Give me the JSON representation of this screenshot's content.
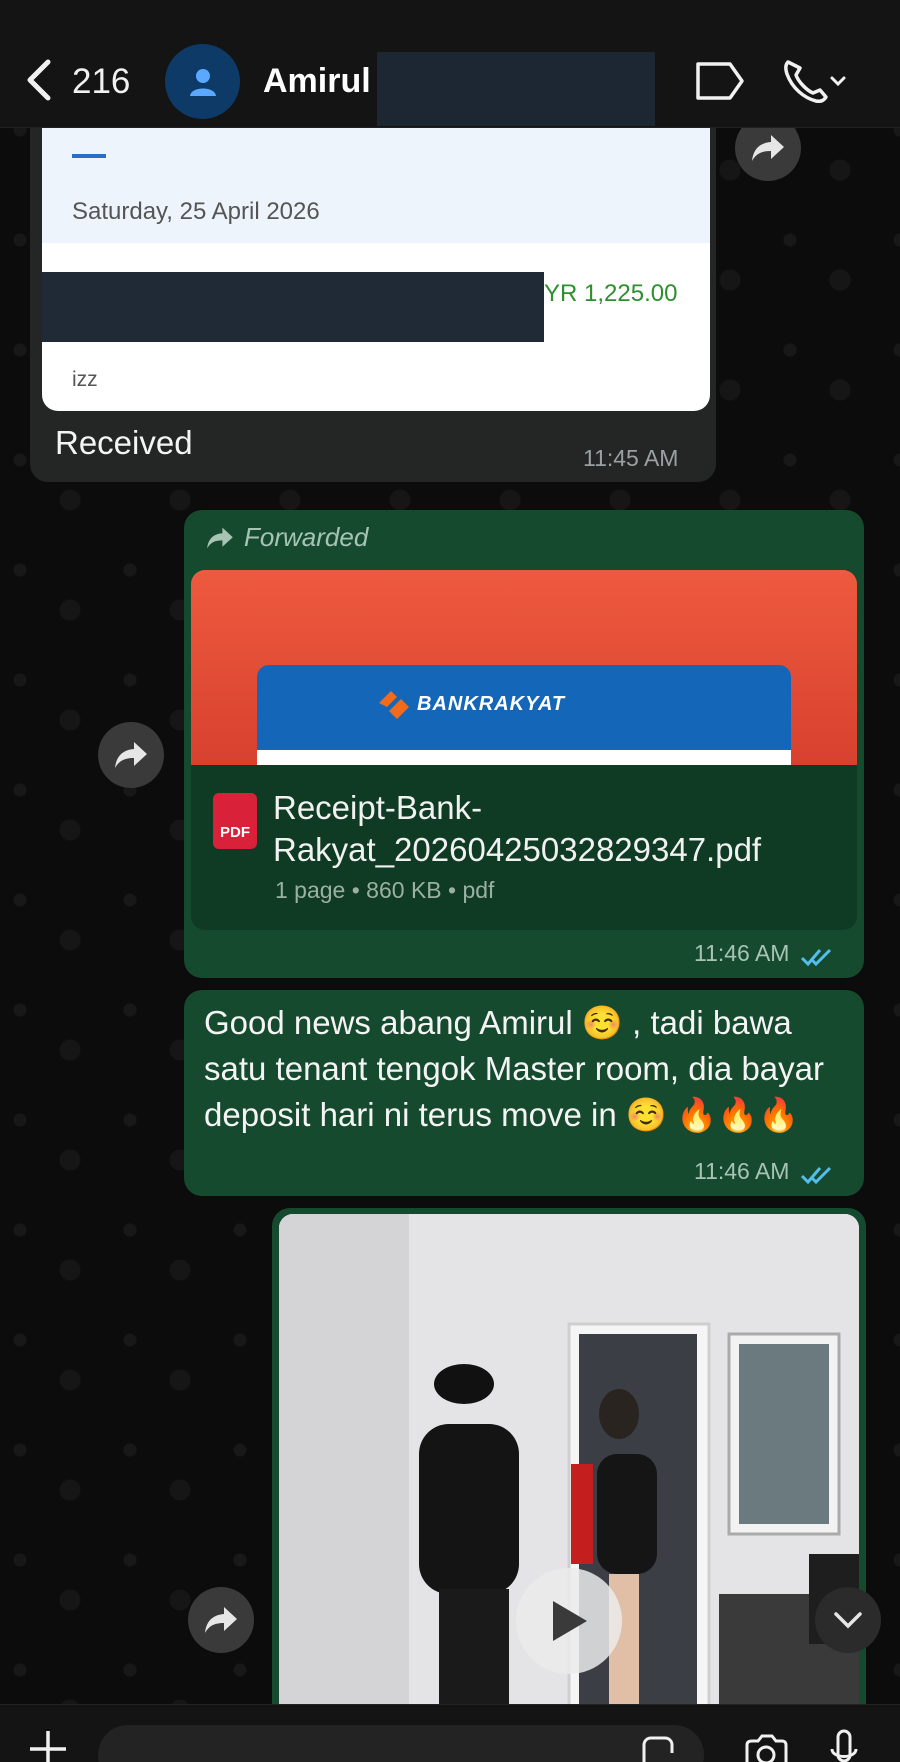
{
  "header": {
    "back_count": "216",
    "contact_name": "Amirul"
  },
  "messages": {
    "incoming": {
      "card_date": "Saturday, 25 April 2026",
      "card_amount": "YR 1,225.00",
      "card_footer": "izz",
      "text": "Received",
      "time": "11:45 AM"
    },
    "document": {
      "forwarded_label": "Forwarded",
      "preview_brand": "BANKRAKYAT",
      "icon_label": "PDF",
      "file_name": "Receipt-Bank-Rakyat_20260425032829347.pdf",
      "meta": "1 page • 860 KB • pdf",
      "time": "11:46 AM"
    },
    "text_message": {
      "text": "Good news abang Amirul ☺️ , tadi bawa satu tenant tengok Master room, dia bayar deposit hari ni terus move in ☺️ 🔥🔥🔥",
      "time": "11:46 AM"
    }
  },
  "colors": {
    "outgoing_bubble": "#164a2f",
    "incoming_bubble": "#242626",
    "read_ticks": "#53bdeb"
  }
}
